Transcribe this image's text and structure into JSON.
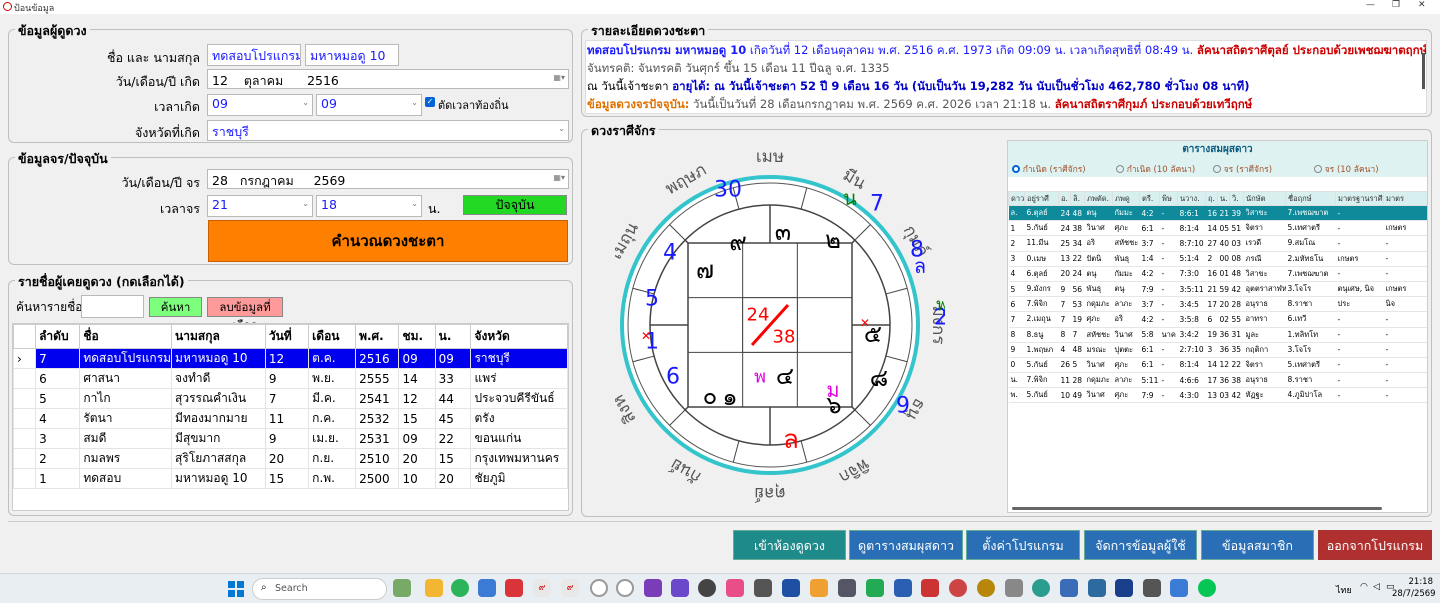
{
  "window": {
    "title": "ป้อนข้อมูล"
  },
  "owner": {
    "title": "ข้อมูลผู้ดูดวง",
    "name_label": "ชื่อ และ นามสกุล",
    "first_name": "ทดสอบโปรแกรม",
    "last_name": "มหาหมอดู 10",
    "dob_label": "วัน/เดือน/ปี เกิด",
    "dob_day": "12",
    "dob_month": "ตุลาคม",
    "dob_year": "2516",
    "time_label": "เวลาเกิด",
    "hour": "09",
    "minute": "09",
    "local_time_label": "ตัดเวลาท้องถิ่น",
    "province_label": "จังหวัดที่เกิด",
    "province": "ราชบุรี"
  },
  "transit": {
    "title": "ข้อมูลจร/ปัจจุบัน",
    "date_label": "วัน/เดือน/ปี จร",
    "day": "28",
    "month": "กรกฎาคม",
    "year": "2569",
    "time_label": "เวลาจร",
    "hour": "21",
    "minute": "18",
    "unit": "น.",
    "now_button": "ปัจจุบัน",
    "calc_button": "คำนวณดวงชะตา"
  },
  "history": {
    "title": "รายชื่อผู้เคยดูดวง (กดเลือกได้)",
    "search_label": "ค้นหารายชื่อ :",
    "search_value": "",
    "search_button": "ค้นหา",
    "delete_button": "ลบข้อมูลที่เลือก",
    "columns": [
      "ลำดับ",
      "ชื่อ",
      "นามสกุล",
      "วันที่",
      "เดือน",
      "พ.ศ.",
      "ชม.",
      "น.",
      "จังหวัด"
    ],
    "rows": [
      [
        "7",
        "ทดสอบโปรแกรม",
        "มหาหมอดู 10",
        "12",
        "ต.ค.",
        "2516",
        "09",
        "09",
        "ราชบุรี"
      ],
      [
        "6",
        "ศาสนา",
        "จงทำดี",
        "9",
        "พ.ย.",
        "2555",
        "14",
        "33",
        "แพร่"
      ],
      [
        "5",
        "กาไก",
        "สุวรรณคำเงิน",
        "7",
        "มี.ค.",
        "2541",
        "12",
        "44",
        "ประจวบคีรีขันธ์"
      ],
      [
        "4",
        "รัตนา",
        "มีทองมากมาย",
        "11",
        "ก.ค.",
        "2532",
        "15",
        "45",
        "ตรัง"
      ],
      [
        "3",
        "สมดี",
        "มีสุขมาก",
        "9",
        "เม.ย.",
        "2531",
        "09",
        "22",
        "ขอนแก่น"
      ],
      [
        "2",
        "กมลพร",
        "สุริโยภาสสกุล",
        "20",
        "ก.ย.",
        "2510",
        "20",
        "15",
        "กรุงเทพมหานคร"
      ],
      [
        "1",
        "ทดสอบ",
        "มหาหมอดู 10",
        "15",
        "ก.พ.",
        "2500",
        "10",
        "20",
        "ชัยภูมิ"
      ]
    ]
  },
  "details": {
    "title": "รายละเอียดดวงชะตา",
    "line1a": "ทดสอบโปรแกรม มหาหมอดู 10",
    "line1b": "เกิดวันที่ 12 เดือนตุลาคม พ.ศ. 2516 ค.ศ. 1973  เกิด 09:09 น. เวลาเกิดสุทธิที่  08:49 น.",
    "line1c": "ลัคนาสถิตราศีตุลย์ ประกอบด้วยเพชฌฆาตฤกษ์",
    "line2": "จันทรคติ: จันทรคติ วันศุกร์ ขึ้น 15 เดือน 11 ปีฉลู จ.ศ. 1335",
    "line3a": "ณ วันนี้เจ้าชะตา",
    "line3b": "อายุได้: ณ วันนี้เจ้าชะตา  52 ปี 9 เดือน 16 วัน (นับเป็นวัน 19,282 วัน นับเป็นชั่วโมง 462,780 ชั่วโมง 08 นาที)",
    "line4a": "ข้อมูลดวงจรปัจจุบัน:",
    "line4b": "วันนี้เป็นวันที่ 28 เดือนกรกฎาคม พ.ศ. 2569 ค.ศ. 2026 เวลา 21:18 น.",
    "line4c": "ลัคนาสถิตราศีกุมภ์ ประกอบด้วยเทวีฤกษ์"
  },
  "chart": {
    "title": "ดวงราศีจักร",
    "zodiac": [
      "เมษ",
      "มีน",
      "กุมภ์",
      "มังกร",
      "ธนู",
      "พิจิก",
      "ตุลย์",
      "กันย์",
      "สิงห์",
      "กรกฎ",
      "เมถุน",
      "พฤษภ"
    ],
    "center_top": "24",
    "center_bottom": "38",
    "outer": [
      "30",
      "7",
      "8",
      "2",
      "9",
      "6",
      "1",
      "5",
      "4"
    ],
    "natal": [
      "๙",
      "๓",
      "๒",
      "๗",
      "๕",
      "๑",
      "๔",
      "๘",
      "๖",
      "๐"
    ],
    "marks": [
      "น",
      "ล",
      "พ",
      "พ",
      "ม",
      "ล"
    ],
    "colors": {
      "ring": "#33c4cc",
      "transit": "#1a1aff",
      "natal": "#000000",
      "lagna": "#ff0000",
      "magenta": "#e000e0",
      "green": "#008000",
      "center": "#ff0000"
    }
  },
  "table": {
    "title": "ตารางสมผุสดาว",
    "radio1": "กำเนิด (ราศีจักร)",
    "radio2": "กำเนิด (10 ลัคนา)",
    "radio3": "จร (ราศีจักร)",
    "radio4": "จร (10 ลัคนา)",
    "columns": [
      "ดาว",
      "อยู่ราศี",
      "อ.",
      "ลิ.",
      "ภพตัด.",
      "ภพดู",
      "ตรี.",
      "พิษ",
      "นวาง.",
      "ฤ.",
      "น.",
      "วิ.",
      "นักษัต",
      "ชื่อฤกษ์",
      "มาตรฐานราศี",
      "มาตร"
    ],
    "rows": [
      [
        "ล.",
        "6.ตุลย์",
        "24",
        "48",
        "ตนุ",
        "กัมมะ",
        "4:2",
        "-",
        "8:6:1",
        "16",
        "21",
        "39",
        "วิสาขะ",
        "7.เพชฌฆาต",
        "-",
        ""
      ],
      [
        "1",
        "5.กันย์",
        "24",
        "38",
        "วินาศ",
        "ศุภะ",
        "6:1",
        "-",
        "8:1:4",
        "14",
        "05",
        "51",
        "จิตรา",
        "5.เทศาตรี",
        "-",
        "เกษตร"
      ],
      [
        "2",
        "11.มีน",
        "25",
        "34",
        "อริ",
        "สหัชชะ",
        "3:7",
        "-",
        "8:7:10",
        "27",
        "40",
        "03",
        "เรวดี",
        "9.สมโณ",
        "-",
        "-"
      ],
      [
        "3",
        "0.เมษ",
        "13",
        "22",
        "ปัตนิ",
        "พันธุ",
        "1:4",
        "-",
        "5:1:4",
        "2",
        "00",
        "08",
        "ภรณี",
        "2.มหัทธโน",
        "เกษตร",
        "-"
      ],
      [
        "4",
        "6.ตุลย์",
        "20",
        "24",
        "ตนุ",
        "กัมมะ",
        "4:2",
        "-",
        "7:3:0",
        "16",
        "01",
        "48",
        "วิสาขะ",
        "7.เพชฌฆาต",
        "-",
        "-"
      ],
      [
        "5",
        "9.มังกร",
        "9",
        "56",
        "พันธุ",
        "ตนุ",
        "7:9",
        "-",
        "3:5:11",
        "21",
        "59",
        "42",
        "อุตตราสาฬหะ",
        "3.โจโร",
        "ตนุเศษ, นิจ",
        "เกษตร"
      ],
      [
        "6",
        "7.พิจิก",
        "7",
        "53",
        "กดุมภะ",
        "ลาภะ",
        "3:7",
        "-",
        "3:4:5",
        "17",
        "20",
        "28",
        "อนุราธ",
        "8.ราชา",
        "ประ",
        "นิจ"
      ],
      [
        "7",
        "2.เมถุน",
        "7",
        "19",
        "ศุภะ",
        "อริ",
        "4:2",
        "-",
        "3:5:8",
        "6",
        "02",
        "55",
        "อาทรา",
        "6.เทวี",
        "-",
        "-"
      ],
      [
        "8",
        "8.ธนู",
        "8",
        "7",
        "สหัชชะ",
        "วินาศ",
        "5:8",
        "นาค",
        "3:4:2",
        "19",
        "36",
        "31",
        "มูละ",
        "1.ทลิทโท",
        "-",
        "-"
      ],
      [
        "9",
        "1.พฤษภ",
        "4",
        "48",
        "มรณะ",
        "ปุตตะ",
        "6:1",
        "-",
        "2:7:10",
        "3",
        "36",
        "35",
        "กฤติกา",
        "3.โจโร",
        "-",
        "-"
      ],
      [
        "0",
        "5.กันย์",
        "26",
        "5",
        "วินาศ",
        "ศุภะ",
        "6:1",
        "-",
        "8:1:4",
        "14",
        "12",
        "22",
        "จิตรา",
        "5.เทศาตรี",
        "-",
        "-"
      ],
      [
        "น.",
        "7.พิจิก",
        "11",
        "28",
        "กดุมภะ",
        "ลาภะ",
        "5:11",
        "-",
        "4:6:6",
        "17",
        "36",
        "38",
        "อนุราธ",
        "8.ราชา",
        "-",
        "-"
      ],
      [
        "พ.",
        "5.กันย์",
        "10",
        "49",
        "วินาศ",
        "ศุภะ",
        "7:9",
        "-",
        "4:3:0",
        "13",
        "03",
        "42",
        "หัฏฐะ",
        "4.ภูมิปาโล",
        "-",
        "-"
      ]
    ]
  },
  "buttons": {
    "room": "เข้าห้องดูดวง",
    "view_table": "ดูตารางสมผุสดาว",
    "settings": "ตั้งค่าโปรแกรม",
    "users": "จัดการข้อมูลผู้ใช้",
    "member": "ข้อมูลสมาชิก",
    "exit": "ออกจากโปรแกรม"
  },
  "taskbar": {
    "search": "Search",
    "lang": "ไทย",
    "time": "21:18",
    "date": "28/7/2569"
  }
}
